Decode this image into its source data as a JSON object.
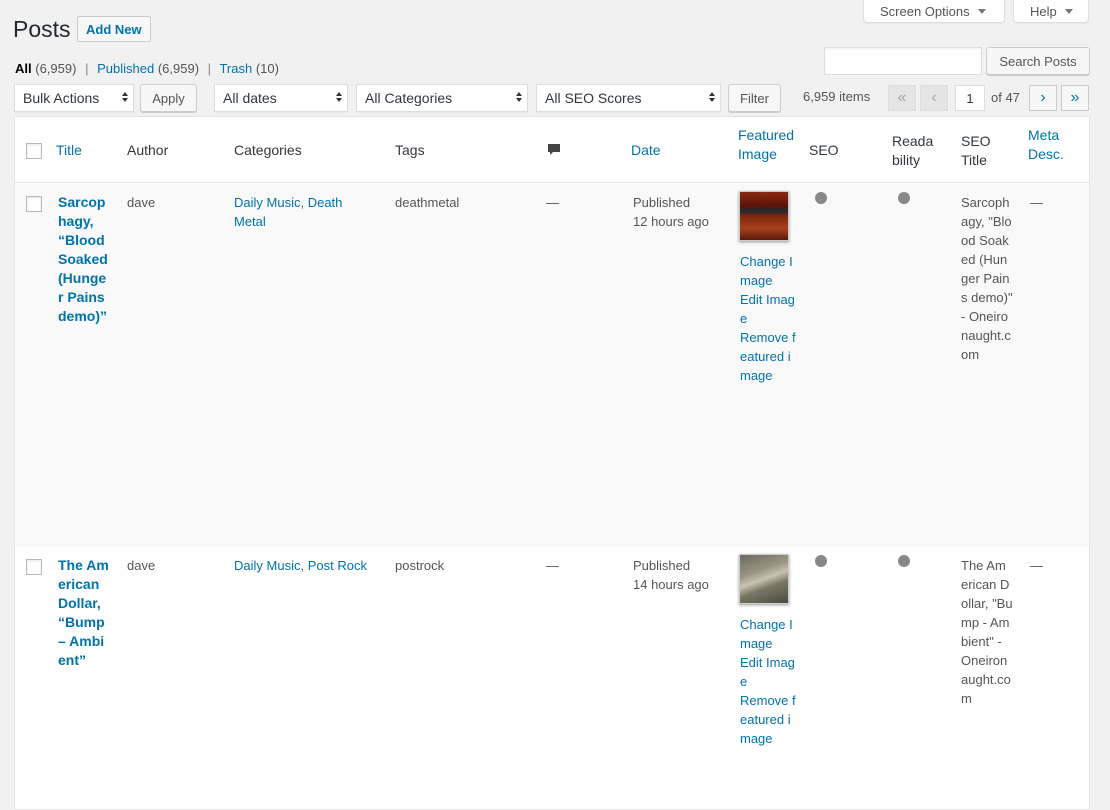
{
  "top": {
    "screen_options": "Screen Options",
    "help": "Help"
  },
  "page": {
    "title": "Posts",
    "add_new": "Add New"
  },
  "views": {
    "all": "All",
    "all_count": "(6,959)",
    "published": "Published",
    "published_count": "(6,959)",
    "trash": "Trash",
    "trash_count": "(10)"
  },
  "search": {
    "value": "",
    "button": "Search Posts"
  },
  "filters": {
    "bulk_actions": "Bulk Actions",
    "apply": "Apply",
    "dates": "All dates",
    "categories": "All Categories",
    "seo_scores": "All SEO Scores",
    "filter": "Filter"
  },
  "pagination": {
    "items": "6,959 items",
    "current_page": "1",
    "of_pages": "of 47",
    "first": "«",
    "prev": "‹",
    "next": "›",
    "last": "»"
  },
  "columns": {
    "title": "Title",
    "author": "Author",
    "categories": "Categories",
    "tags": "Tags",
    "date": "Date",
    "featured_image": "Featured Image",
    "seo": "SEO",
    "readability": "Readability",
    "seo_title": "SEO Title",
    "meta_desc": "Meta Desc."
  },
  "rows": [
    {
      "title": "Sarcophagy, “Blood Soaked (Hunger Pains demo)”",
      "author": "dave",
      "categories": [
        "Daily Music",
        "Death Metal"
      ],
      "tags": "deathmetal",
      "comments": "—",
      "date_status": "Published",
      "date_ago": "12 hours ago",
      "change_image": "Change Image",
      "edit_image": "Edit Image",
      "remove_image": "Remove featured image",
      "seo_title": "Sarcophagy, \"Blood Soaked (Hunger Pains demo)\" - Oneironaught.com",
      "meta_desc": "—"
    },
    {
      "title": "The American Dollar, “Bump – Ambient”",
      "author": "dave",
      "categories": [
        "Daily Music",
        "Post Rock"
      ],
      "tags": "postrock",
      "comments": "—",
      "date_status": "Published",
      "date_ago": "14 hours ago",
      "change_image": "Change Image",
      "edit_image": "Edit Image",
      "remove_image": "Remove featured image",
      "seo_title": "The American Dollar, \"Bump - Ambient\" - Oneironaught.com",
      "meta_desc": "—"
    }
  ],
  "colors": {
    "link": "#0073aa",
    "score_dot": "#888888"
  }
}
